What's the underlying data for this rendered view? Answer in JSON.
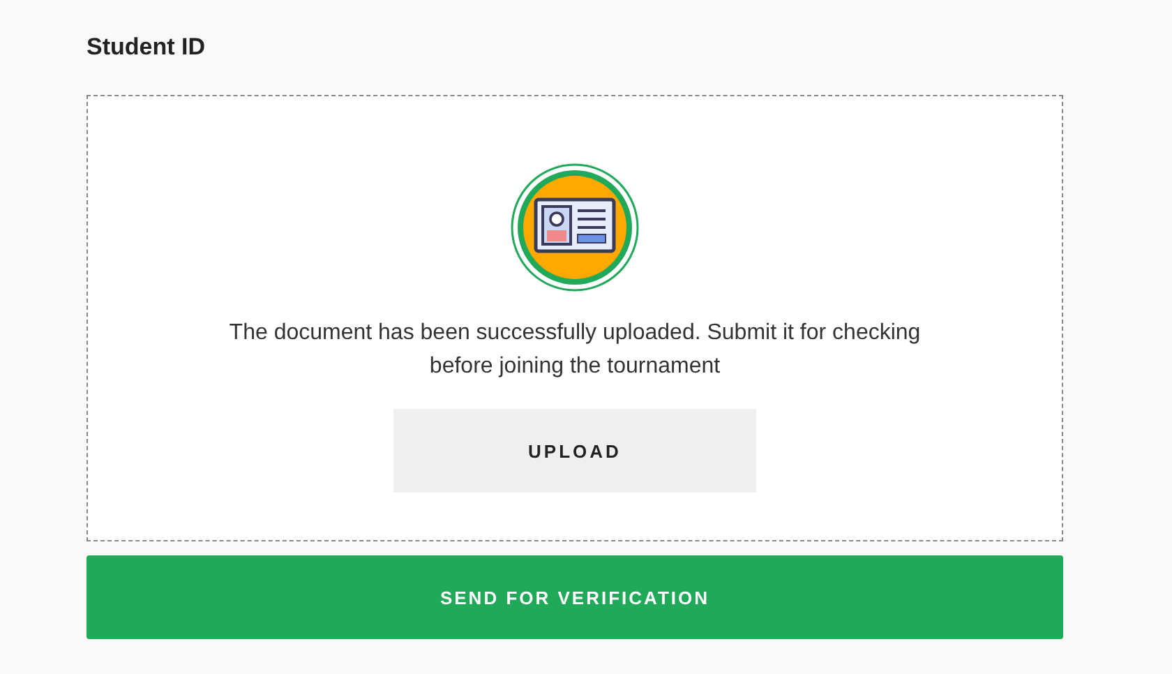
{
  "section_title": "Student ID",
  "upload_area": {
    "message": "The document has been successfully uploaded. Submit it for checking before joining the tournament",
    "upload_button": "UPLOAD"
  },
  "submit_button": "SEND FOR VERIFICATION"
}
